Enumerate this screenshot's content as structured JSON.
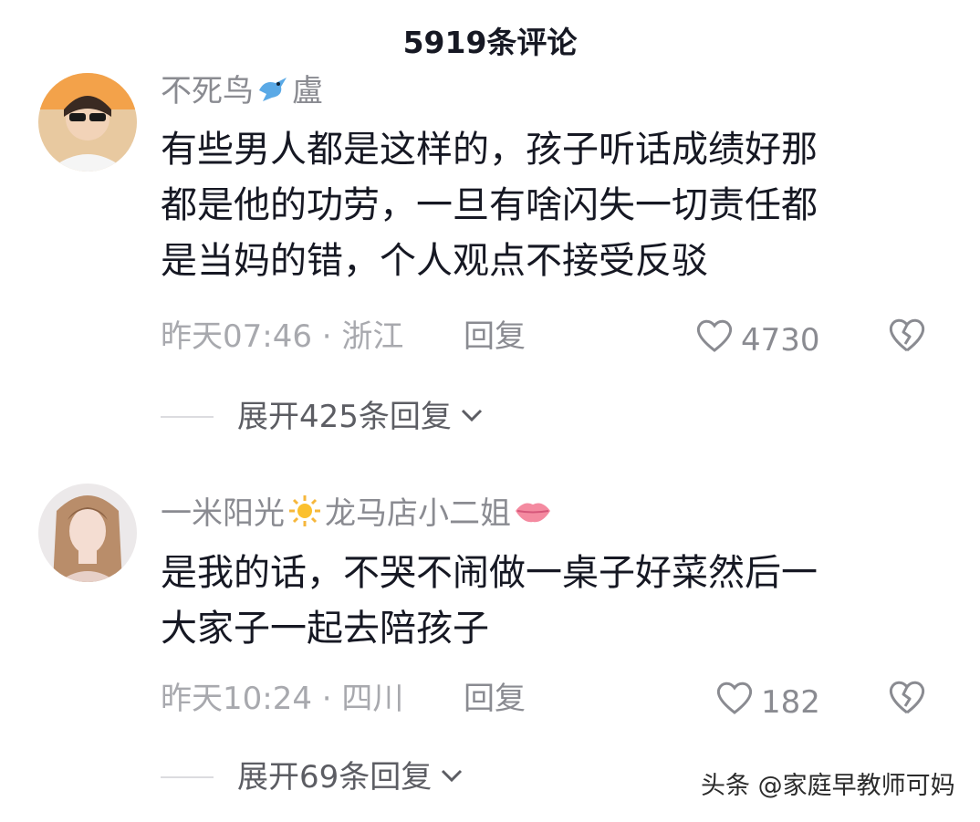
{
  "header": {
    "title": "5919条评论"
  },
  "comments": [
    {
      "username": "不死鸟",
      "username_suffix": "盧",
      "emoji_icon": "bird-icon",
      "lines": [
        "有些男人都是这样的，孩子听话成绩好那",
        "都是他的功劳，一旦有啥闪失一切责任都",
        "是当妈的错，个人观点不接受反驳"
      ],
      "time": "昨天07:46",
      "location": "浙江",
      "separator": " · ",
      "reply_label": "回复",
      "likes": "4730",
      "expand_label": "展开425条回复"
    },
    {
      "username": "一米阳光",
      "username_suffix": "龙马店小二姐",
      "emoji_icon": "sun-icon",
      "trailing_icon": "lips-icon",
      "lines": [
        "是我的话，不哭不闹做一桌子好菜然后一",
        "大家子一起去陪孩子"
      ],
      "time": "昨天10:24",
      "location": "四川",
      "separator": " · ",
      "reply_label": "回复",
      "likes": "182",
      "expand_label": "展开69条回复"
    }
  ],
  "watermark": "头条 @家庭早教师可妈",
  "colors": {
    "like_outline": "#8a8b91",
    "username": "#8a8b91",
    "text": "#161823"
  }
}
